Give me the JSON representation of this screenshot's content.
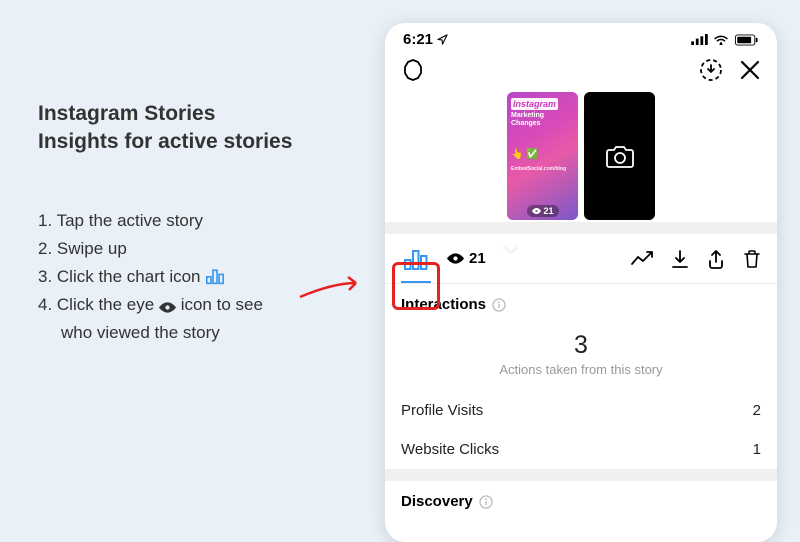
{
  "title_line1": "Instagram Stories",
  "title_line2": "Insights for active stories",
  "steps": {
    "s1": "1. Tap the active story",
    "s2": "2. Swipe up",
    "s3": "3. Click the chart icon",
    "s4": "4. Click the eye",
    "s4b": "icon to see",
    "s4c": "who viewed the story"
  },
  "status_time": "6:21",
  "story_thumb": {
    "brand": "Instagram",
    "headline": "Marketing Changes",
    "blog": "EmbedSocial.com/blog",
    "view_count": "21"
  },
  "tabs": {
    "views_count": "21"
  },
  "interactions": {
    "header": "Interactions",
    "count": "3",
    "subtitle": "Actions taken from this story",
    "rows": [
      {
        "label": "Profile Visits",
        "value": "2"
      },
      {
        "label": "Website Clicks",
        "value": "1"
      }
    ]
  },
  "discovery_header": "Discovery"
}
